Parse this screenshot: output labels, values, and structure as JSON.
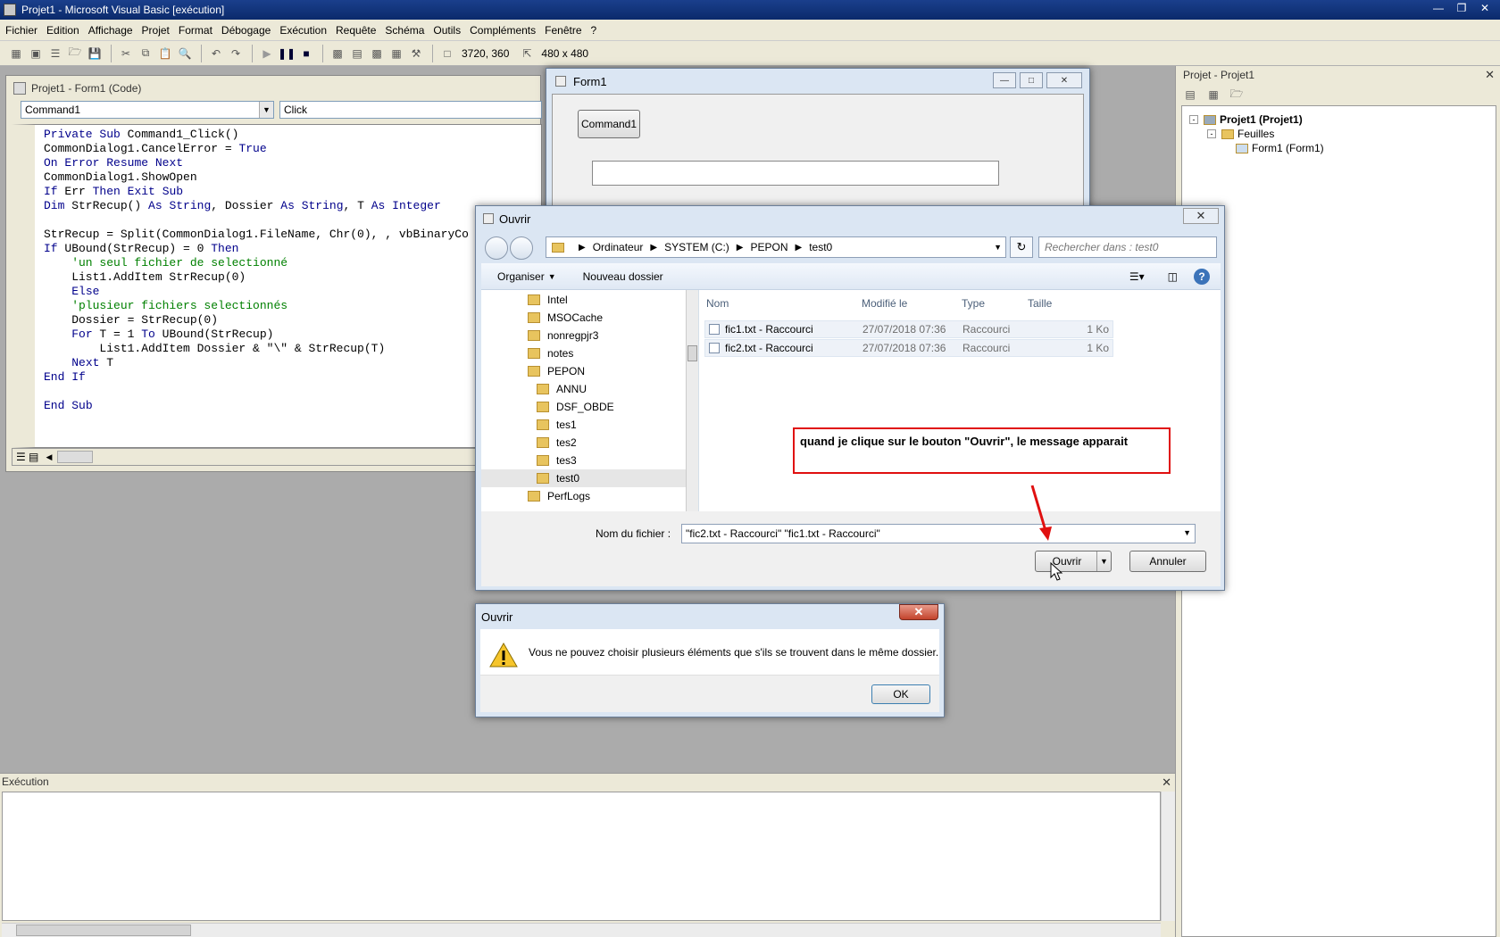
{
  "app": {
    "title": "Projet1 - Microsoft Visual Basic [exécution]"
  },
  "menu": [
    "Fichier",
    "Edition",
    "Affichage",
    "Projet",
    "Format",
    "Débogage",
    "Exécution",
    "Requête",
    "Schéma",
    "Outils",
    "Compléments",
    "Fenêtre",
    "?"
  ],
  "toolbar": {
    "position": "3720, 360",
    "size": "480 x 480"
  },
  "code_window": {
    "title": "Projet1 - Form1 (Code)",
    "object_combo": "Command1",
    "proc_combo": "Click",
    "lines": [
      "Private Sub Command1_Click()",
      "CommonDialog1.CancelError = True",
      "On Error Resume Next",
      "CommonDialog1.ShowOpen",
      "If Err Then Exit Sub",
      "Dim StrRecup() As String, Dossier As String, T As Integer",
      "",
      "StrRecup = Split(CommonDialog1.FileName, Chr(0), , vbBinaryCo",
      "If UBound(StrRecup) = 0 Then",
      "    'un seul fichier de selectionné",
      "    List1.AddItem StrRecup(0)",
      "    Else",
      "    'plusieur fichiers selectionnés",
      "    Dossier = StrRecup(0)",
      "    For T = 1 To UBound(StrRecup)",
      "        List1.AddItem Dossier & \"\\\" & StrRecup(T)",
      "    Next T",
      "End If",
      "",
      "End Sub"
    ]
  },
  "form1": {
    "title": "Form1",
    "button": "Command1"
  },
  "project": {
    "title": "Projet - Projet1",
    "root": "Projet1 (Projet1)",
    "folder": "Feuilles",
    "item": "Form1 (Form1)"
  },
  "execution": {
    "title": "Exécution"
  },
  "open_dialog": {
    "title": "Ouvrir",
    "breadcrumb": [
      "Ordinateur",
      "SYSTEM (C:)",
      "PEPON",
      "test0"
    ],
    "search_placeholder": "Rechercher dans : test0",
    "organize": "Organiser",
    "new_folder": "Nouveau dossier",
    "folders": [
      "Intel",
      "MSOCache",
      "nonregpjr3",
      "notes",
      "PEPON",
      "ANNU",
      "DSF_OBDE",
      "tes1",
      "tes2",
      "tes3",
      "test0",
      "PerfLogs"
    ],
    "columns": [
      "Nom",
      "Modifié le",
      "Type",
      "Taille"
    ],
    "files": [
      {
        "name": "fic1.txt - Raccourci",
        "modified": "27/07/2018 07:36",
        "type": "Raccourci",
        "size": "1 Ko"
      },
      {
        "name": "fic2.txt - Raccourci",
        "modified": "27/07/2018 07:36",
        "type": "Raccourci",
        "size": "1 Ko"
      }
    ],
    "filename_label": "Nom du fichier :",
    "filename_value": "\"fic2.txt - Raccourci\" \"fic1.txt - Raccourci\"",
    "open_button": "Ouvrir",
    "cancel_button": "Annuler"
  },
  "annotation": {
    "text": "quand je clique sur le bouton \"Ouvrir\", le message apparait",
    "color": "#e01010"
  },
  "message_box": {
    "title": "Ouvrir",
    "text": "Vous ne pouvez choisir plusieurs éléments que s'ils se trouvent dans le même dossier.",
    "ok": "OK",
    "icon": "warning-icon"
  }
}
